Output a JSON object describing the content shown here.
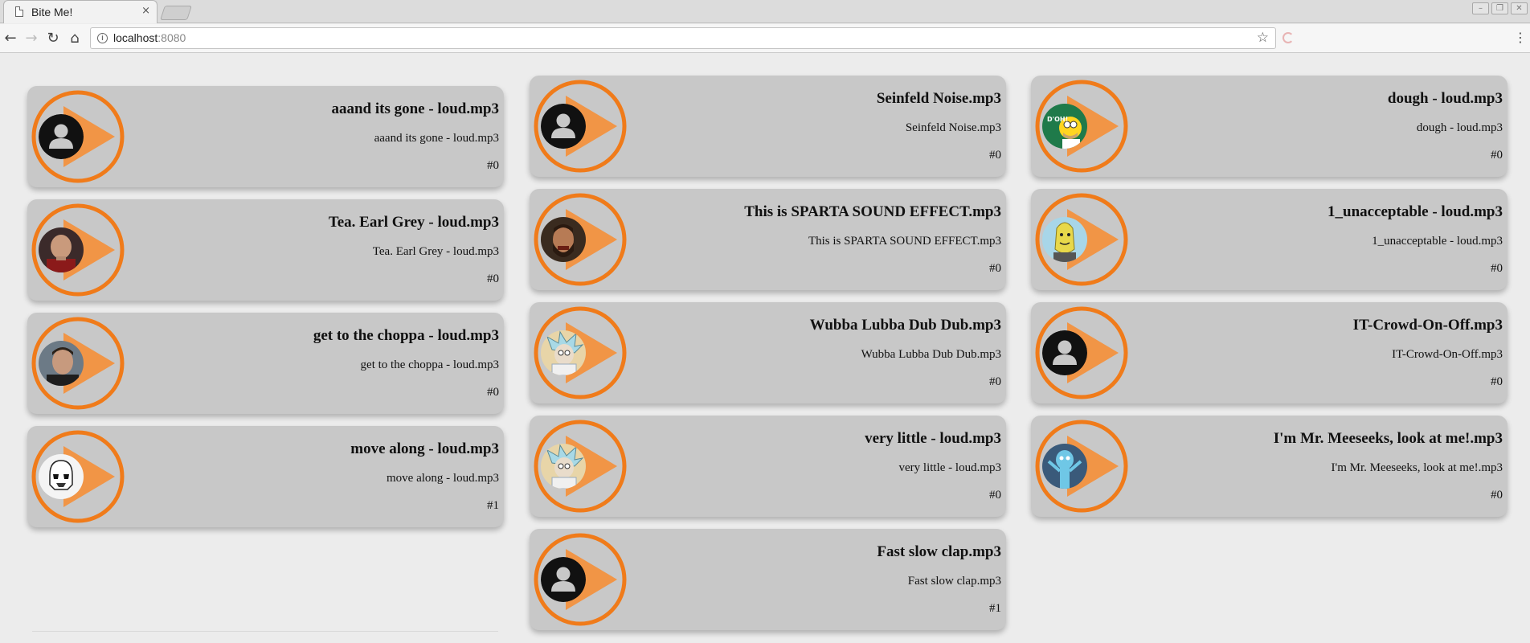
{
  "browser": {
    "tab_title": "Bite Me!",
    "tab_close": "×",
    "url_host": "localhost",
    "url_port": ":8080",
    "window_controls": [
      "–",
      "❐",
      "✕"
    ]
  },
  "colors": {
    "accent": "#f07b1a",
    "card_bg": "#c8c8c8",
    "page_bg": "#ececec"
  },
  "columns": [
    [
      {
        "title": "aaand its gone - loud.mp3",
        "subtitle": "aaand its gone - loud.mp3",
        "count": "#0",
        "avatar": "default-user-icon"
      },
      {
        "title": "Tea. Earl Grey - loud.mp3",
        "subtitle": "Tea. Earl Grey - loud.mp3",
        "count": "#0",
        "avatar": "picard-portrait"
      },
      {
        "title": "get to the choppa - loud.mp3",
        "subtitle": "get to the choppa - loud.mp3",
        "count": "#0",
        "avatar": "terminator-portrait"
      },
      {
        "title": "move along - loud.mp3",
        "subtitle": "move along - loud.mp3",
        "count": "#1",
        "avatar": "stormtrooper-portrait"
      }
    ],
    [
      {
        "title": "Seinfeld Noise.mp3",
        "subtitle": "Seinfeld Noise.mp3",
        "count": "#0",
        "avatar": "default-user-icon"
      },
      {
        "title": "This is SPARTA SOUND EFFECT.mp3",
        "subtitle": "This is SPARTA SOUND EFFECT.mp3",
        "count": "#0",
        "avatar": "leonidas-portrait"
      },
      {
        "title": "Wubba Lubba Dub Dub.mp3",
        "subtitle": "Wubba Lubba Dub Dub.mp3",
        "count": "#0",
        "avatar": "rick-portrait"
      },
      {
        "title": "very little - loud.mp3",
        "subtitle": "very little - loud.mp3",
        "count": "#0",
        "avatar": "rick-portrait"
      },
      {
        "title": "Fast slow clap.mp3",
        "subtitle": "Fast slow clap.mp3",
        "count": "#1",
        "avatar": "default-user-icon"
      }
    ],
    [
      {
        "title": "dough - loud.mp3",
        "subtitle": "dough - loud.mp3",
        "count": "#0",
        "avatar": "homer-doh-portrait",
        "avatar_text": "D'OH!"
      },
      {
        "title": "1_unacceptable - loud.mp3",
        "subtitle": "1_unacceptable - loud.mp3",
        "count": "#0",
        "avatar": "lemongrab-portrait"
      },
      {
        "title": "IT-Crowd-On-Off.mp3",
        "subtitle": "IT-Crowd-On-Off.mp3",
        "count": "#0",
        "avatar": "default-user-icon"
      },
      {
        "title": "I'm Mr. Meeseeks, look at me!.mp3",
        "subtitle": "I'm Mr. Meeseeks, look at me!.mp3",
        "count": "#0",
        "avatar": "meeseeks-portrait"
      }
    ]
  ]
}
